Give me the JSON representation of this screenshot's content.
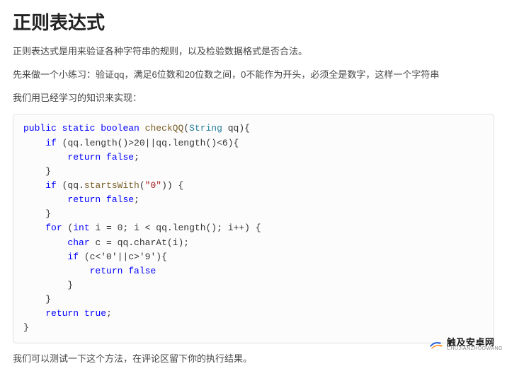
{
  "title": "正则表达式",
  "paragraphs": {
    "p1": "正则表达式是用来验证各种字符串的规则，以及检验数据格式是否合法。",
    "p2": "先来做一个小练习：验证qq，满足6位数和20位数之间，0不能作为开头，必须全是数字，这样一个字符串",
    "p3": "我们用已经学习的知识来实现：",
    "p4": "我们可以测试一下这个方法，在评论区留下你的执行结果。"
  },
  "code": {
    "kw_public": "public",
    "kw_static": "static",
    "kw_boolean": "boolean",
    "fn_checkQQ": "checkQQ",
    "type_String": "String",
    "param_qq": "qq",
    "kw_if1": "if",
    "cond1_a": "qq.length()>20",
    "cond1_b": "qq.length()<6",
    "kw_return": "return",
    "kw_false": "false",
    "kw_if2": "if",
    "m_startsWith": "startsWith",
    "lit_zero": "\"0\"",
    "kw_for": "for",
    "kw_int": "int",
    "loop_init": "i = 0",
    "loop_cond": "i < qq.length()",
    "loop_inc": "i++",
    "kw_char": "char",
    "charAt_line": "c = qq.charAt(i);",
    "cond3": "c<'0'||c>'9'",
    "kw_true": "true"
  },
  "footer": {
    "brand_cn": "触及安卓网",
    "brand_py": "CHUJIANZHUOWANG"
  }
}
